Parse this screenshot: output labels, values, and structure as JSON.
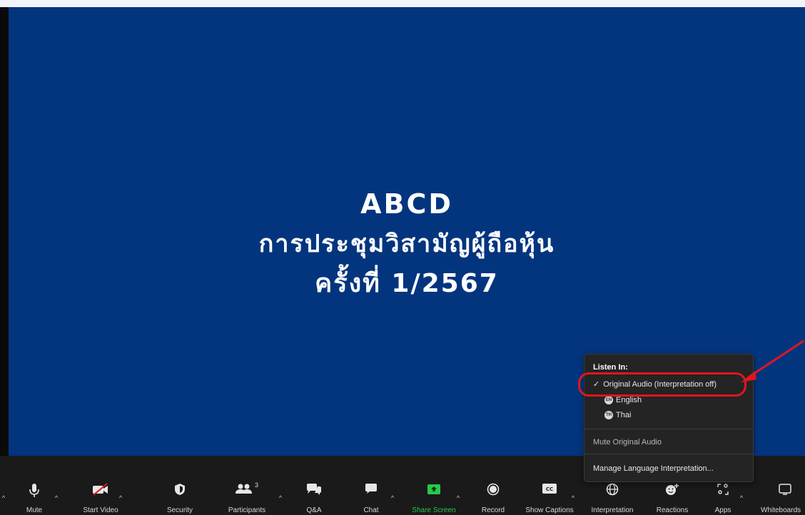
{
  "slide": {
    "line1": "ABCD",
    "line2": "การประชุมวิสามัญผู้ถือหุ้น",
    "line3": "ครั้งที่ 1/2567"
  },
  "menu": {
    "header": "Listen In:",
    "items": [
      {
        "label": "Original Audio (Interpretation off)",
        "checked": true
      },
      {
        "label": "English",
        "badge": "EN"
      },
      {
        "label": "Thai",
        "badge": "TH"
      }
    ],
    "mute_label": "Mute Original Audio",
    "manage_label": "Manage Language Interpretation..."
  },
  "toolbar": {
    "mute": "Mute",
    "start_video": "Start Video",
    "security": "Security",
    "participants": "Participants",
    "participants_count": "3",
    "qa": "Q&A",
    "chat": "Chat",
    "share_screen": "Share Screen",
    "record": "Record",
    "show_captions": "Show Captions",
    "interpretation": "Interpretation",
    "reactions": "Reactions",
    "apps": "Apps",
    "whiteboards": "Whiteboards"
  },
  "colors": {
    "stage": "#03357f",
    "toolbar": "#1a1a1a",
    "share_green": "#28c84a",
    "highlight_red": "#e0161e"
  }
}
